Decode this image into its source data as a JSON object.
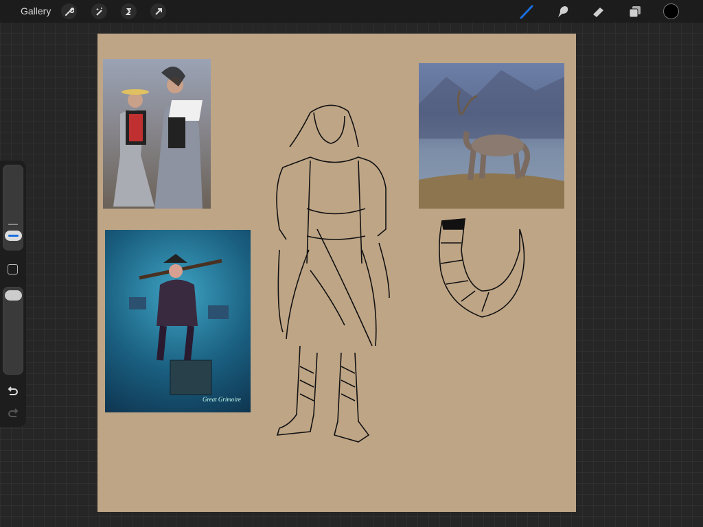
{
  "topbar": {
    "gallery_label": "Gallery",
    "left_tools": [
      "wrench-icon",
      "magic-wand-icon",
      "selection-icon",
      "move-arrow-icon"
    ],
    "right_tools": [
      "brush-icon",
      "smudge-icon",
      "eraser-icon",
      "layers-icon",
      "color-picker"
    ],
    "active_tool_color": "#1a6fe0",
    "current_color": "#000000"
  },
  "sidebar": {
    "brush_size_level": 0.75,
    "opacity_level": 1.0,
    "modify_label": "modify-button",
    "undo": "undo-icon",
    "redo": "redo-icon"
  },
  "canvas": {
    "background_color": "#bea586",
    "references": [
      {
        "name": "traditional-costume-photo"
      },
      {
        "name": "pirate-illustration",
        "watermark": "Great Grimoire"
      },
      {
        "name": "ibex-photo"
      }
    ],
    "sketches": [
      "character-sketch",
      "horn-sketch"
    ]
  }
}
